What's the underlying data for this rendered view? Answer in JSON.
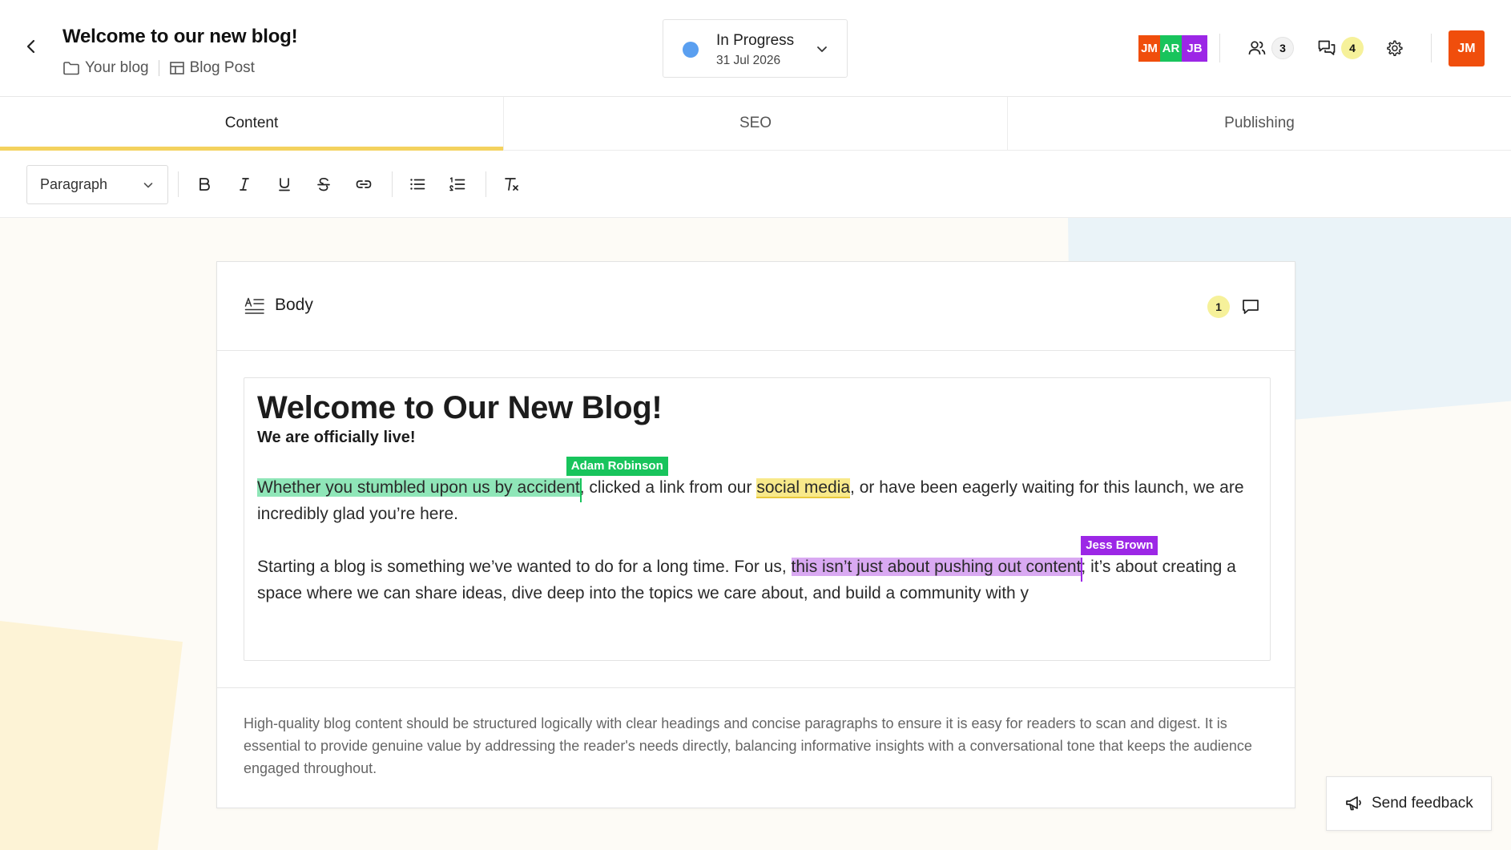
{
  "header": {
    "title": "Welcome to our new blog!",
    "breadcrumbs": [
      "Your blog",
      "Blog Post"
    ],
    "status": {
      "label": "In Progress",
      "date": "31 Jul 2026",
      "color": "#5a9ff0"
    },
    "collaborators": [
      {
        "initials": "JM",
        "color": "#f04e0c"
      },
      {
        "initials": "AR",
        "color": "#18c45c"
      },
      {
        "initials": "JB",
        "color": "#9c27e6"
      }
    ],
    "people_count": "3",
    "comments_count": "4",
    "user_initials": "JM"
  },
  "tabs": [
    {
      "label": "Content",
      "active": true
    },
    {
      "label": "SEO",
      "active": false
    },
    {
      "label": "Publishing",
      "active": false
    }
  ],
  "toolbar": {
    "block_type": "Paragraph",
    "icons": [
      "bold-icon",
      "italic-icon",
      "underline-icon",
      "strikethrough-icon",
      "link-icon",
      "bullet-list-icon",
      "numbered-list-icon",
      "clear-format-icon"
    ]
  },
  "field": {
    "label": "Body",
    "comment_count": "1"
  },
  "editor": {
    "heading": "Welcome to Our New Blog!",
    "subheading": "We are officially live!",
    "p1": {
      "hl1": "Whether you stumbled upon us by accident",
      "t1": ", clicked a link from our ",
      "hl2": "social media",
      "t2": ", or have been eagerly waiting for this launch, we are incredibly glad you’re here."
    },
    "p2": {
      "t1": "Starting a blog is something we’ve wanted to do for a long time. For us, ",
      "hl1": "this isn’t just about pushing out content",
      "t2": "; it’s about creating a space where we can share ideas, dive deep into the topics we care about, and build a community with y"
    },
    "cursors": {
      "adam": {
        "name": "Adam Robinson",
        "color": "#18c45c"
      },
      "jess": {
        "name": "Jess Brown",
        "color": "#9c27e6"
      }
    }
  },
  "hint": "High-quality blog content should be structured logically with clear headings and concise paragraphs to ensure it is easy for readers to scan and digest. It is essential to provide genuine value by addressing the reader's needs directly, balancing informative insights with a conversational tone that keeps the audience engaged throughout.",
  "feedback_label": "Send feedback"
}
